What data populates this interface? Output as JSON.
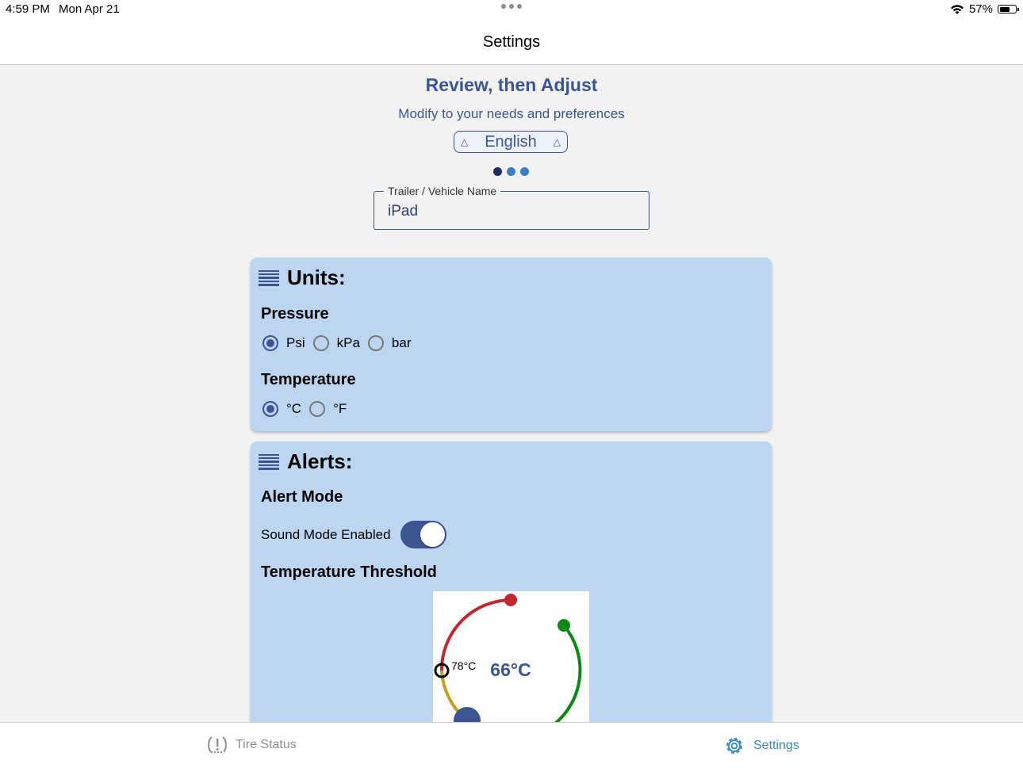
{
  "status_bar": {
    "time": "4:59 PM",
    "date": "Mon Apr 21",
    "battery": "57%",
    "battery_level": 0.57
  },
  "nav": {
    "title": "Settings"
  },
  "header": {
    "title": "Review, then Adjust",
    "subtitle": "Modify to your needs and preferences",
    "language": "English",
    "pager": {
      "count": 3,
      "current": 0
    }
  },
  "vehicle": {
    "label": "Trailer / Vehicle Name",
    "value": "iPad"
  },
  "units": {
    "title": "Units:",
    "pressure_label": "Pressure",
    "pressure_options": [
      "Psi",
      "kPa",
      "bar"
    ],
    "pressure_selected": "Psi",
    "temperature_label": "Temperature",
    "temperature_options": [
      "°C",
      "°F"
    ],
    "temperature_selected": "°C"
  },
  "alerts": {
    "title": "Alerts:",
    "mode_label": "Alert Mode",
    "sound_label": "Sound Mode Enabled",
    "sound_enabled": true,
    "threshold_label": "Temperature Threshold",
    "gauge": {
      "marker_value": "78°C",
      "value": "66°C"
    }
  },
  "tabs": {
    "tire_status": "Tire Status",
    "settings": "Settings",
    "active": "settings"
  },
  "colors": {
    "accent": "#3a5592",
    "card": "#bcd6f1",
    "red": "#c0282e",
    "green": "#0a8a14",
    "amber": "#c8a020",
    "tab_active": "#3a8bc7"
  }
}
